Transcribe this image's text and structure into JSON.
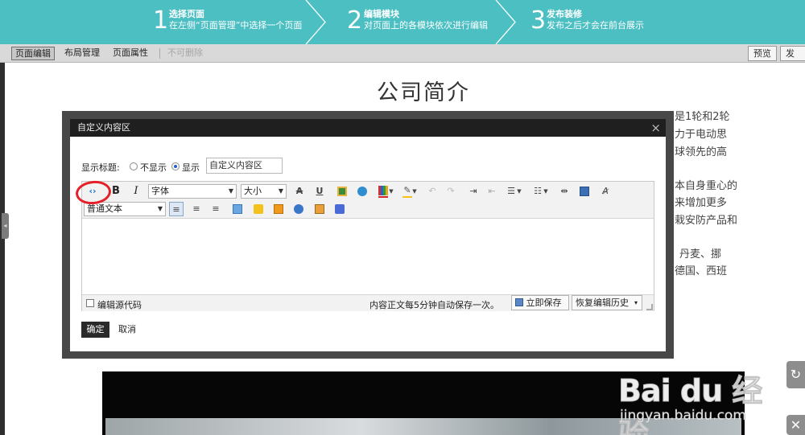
{
  "steps": [
    {
      "num": "1",
      "title": "选择页面",
      "desc": "在左侧“页面管理”中选择一个页面"
    },
    {
      "num": "2",
      "title": "编辑模块",
      "desc": "对页面上的各模块依次进行编辑"
    },
    {
      "num": "3",
      "title": "发布装修",
      "desc": "发布之后才会在前台展示"
    }
  ],
  "editbar": {
    "tabs": [
      "页面编辑",
      "布局管理",
      "页面属性",
      "不可删除"
    ],
    "preview_label": "预览",
    "publish_label": "发"
  },
  "page": {
    "title": "公司简介",
    "body_fragments": [
      "是1轮和2轮",
      "力于电动思",
      "球领先的高",
      "本自身重心的",
      "来增加更多",
      "栽安防产品和",
      "丹麦、挪",
      "德国、西班"
    ]
  },
  "dialog": {
    "title": "自定义内容区",
    "close_glyph": "×",
    "show_title_label": "显示标题:",
    "option_hide": "不显示",
    "option_show": "显示",
    "title_value": "自定义内容区",
    "font_select": "字体",
    "size_select": "大小",
    "para_select": "普通文本",
    "source_code_label": "编辑源代码",
    "autosave_note": "内容正文每5分钟自动保存一次。",
    "save_now_label": "立即保存",
    "restore_label": "恢复编辑历史",
    "ok_label": "确定",
    "cancel_label": "取消"
  },
  "watermark": {
    "brand": "Bai du 经验",
    "url": "jingyan.baidu.com"
  },
  "colors": {
    "banner": "#4cbfc3",
    "annotation": "#e5202a"
  }
}
